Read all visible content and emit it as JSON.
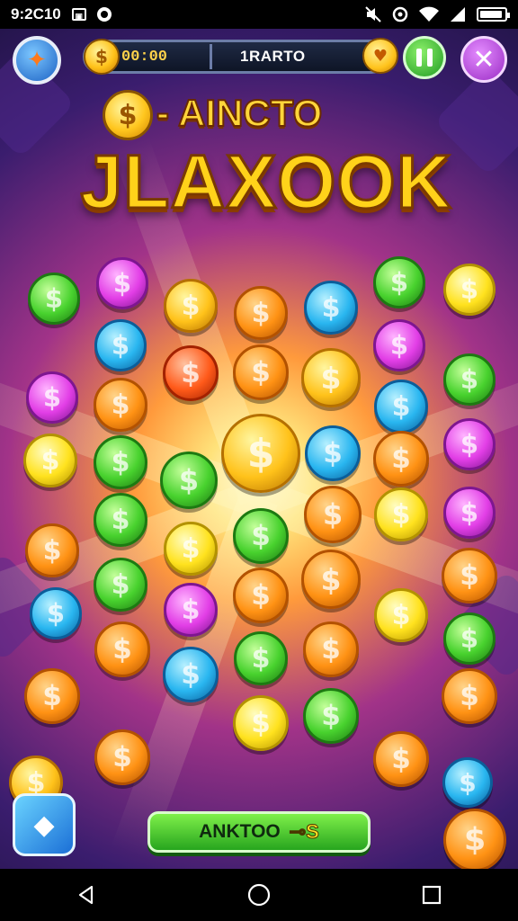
{
  "status_bar": {
    "time": "9:2C10",
    "left_icons": [
      "gallery-icon",
      "notification-icon"
    ],
    "right_icons": [
      "mute-icon",
      "sync-icon",
      "wifi-icon",
      "signal-icon",
      "battery-icon"
    ]
  },
  "top_bar": {
    "timer": "00:00",
    "score_label": "1RARTO",
    "coin_glyph": "$",
    "heart_icon": "heart-icon"
  },
  "buttons": {
    "profile_icon": "profile-badge-icon",
    "pause_icon": "pause-icon",
    "close_icon": "close-icon",
    "close_glyph": "✕"
  },
  "title": {
    "coin_glyph": "$",
    "subtitle": "- AINCTO",
    "main": "JLAXOOK"
  },
  "board": {
    "coin_symbol": "$",
    "colors": {
      "gold": "#ffc21a",
      "orange": "#ff9214",
      "green": "#48d22e",
      "blue": "#29b6f0",
      "pink": "#e23ee6",
      "red": "#ff5a1a",
      "yellow": "#ffe21e"
    }
  },
  "bottom": {
    "tile_icon": "diamond-icon",
    "action_label": "ANKTOO",
    "action_extra": "⊸S"
  },
  "nav": {
    "icons": [
      "back-icon",
      "home-icon",
      "recents-icon"
    ]
  }
}
